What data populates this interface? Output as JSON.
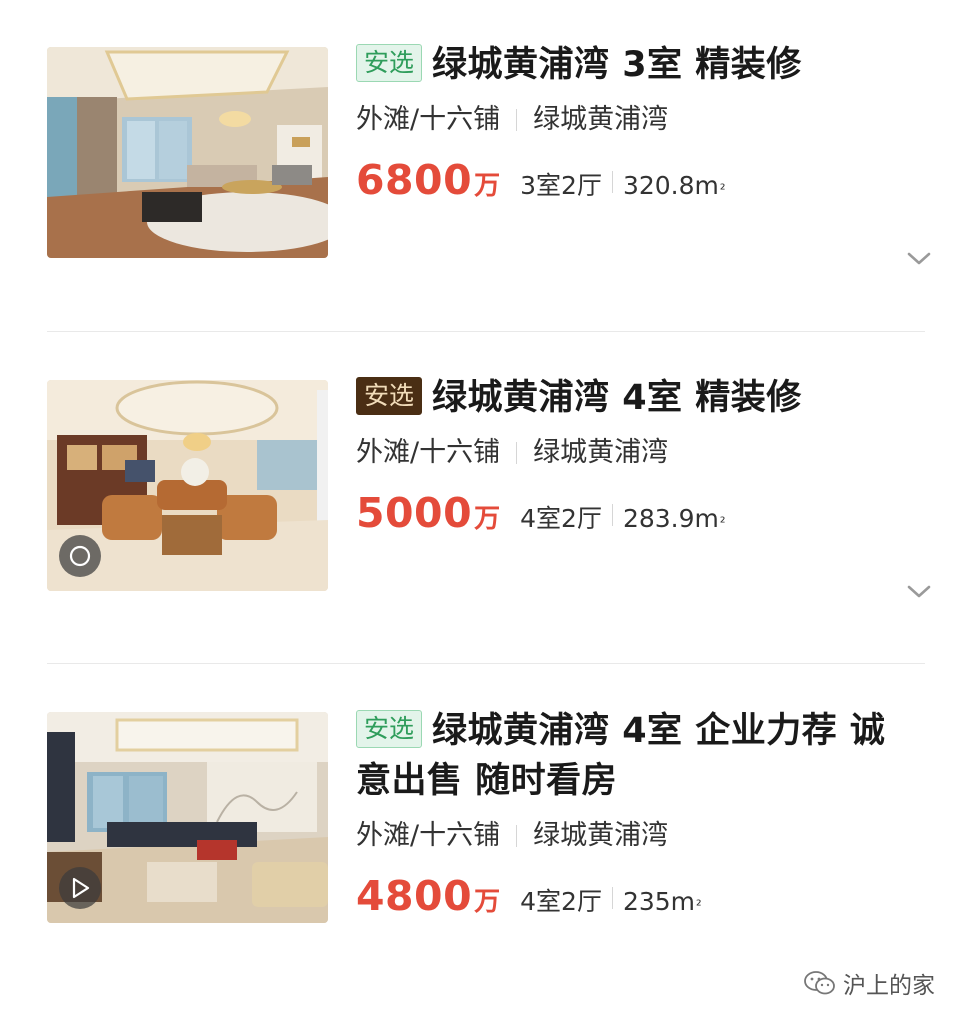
{
  "listings": [
    {
      "tag": "安选",
      "tag_style": "green",
      "title_line1": "绿城黄浦湾 3室 精装修",
      "title_line2": "",
      "district": "外滩/十六铺",
      "community": "绿城黄浦湾",
      "price": "6800",
      "price_unit": "万",
      "layout": "3室2厅",
      "area": "320.8m",
      "area_sup": "²",
      "thumb_badge": "none",
      "has_chevron": true
    },
    {
      "tag": "安选",
      "tag_style": "dark",
      "title_line1": "绿城黄浦湾 4室 精装修",
      "title_line2": "",
      "district": "外滩/十六铺",
      "community": "绿城黄浦湾",
      "price": "5000",
      "price_unit": "万",
      "layout": "4室2厅",
      "area": "283.9m",
      "area_sup": "²",
      "thumb_badge": "vr-icon",
      "has_chevron": true
    },
    {
      "tag": "安选",
      "tag_style": "green",
      "title_line1": "绿城黄浦湾 4室 企业力荐 诚",
      "title_line2": "意出售 随时看房",
      "district": "外滩/十六铺",
      "community": "绿城黄浦湾",
      "price": "4800",
      "price_unit": "万",
      "layout": "4室2厅",
      "area": "235m",
      "area_sup": "²",
      "thumb_badge": "play-icon",
      "has_chevron": false
    }
  ],
  "watermark": {
    "text": "沪上的家",
    "icon": "wechat-icon"
  },
  "colors": {
    "price": "#e44b3a",
    "tag_green_bg": "#e3f4ea",
    "tag_green_text": "#2f9d5b",
    "tag_dark_bg": "#4a2e14",
    "tag_dark_text": "#f1dcb9"
  }
}
